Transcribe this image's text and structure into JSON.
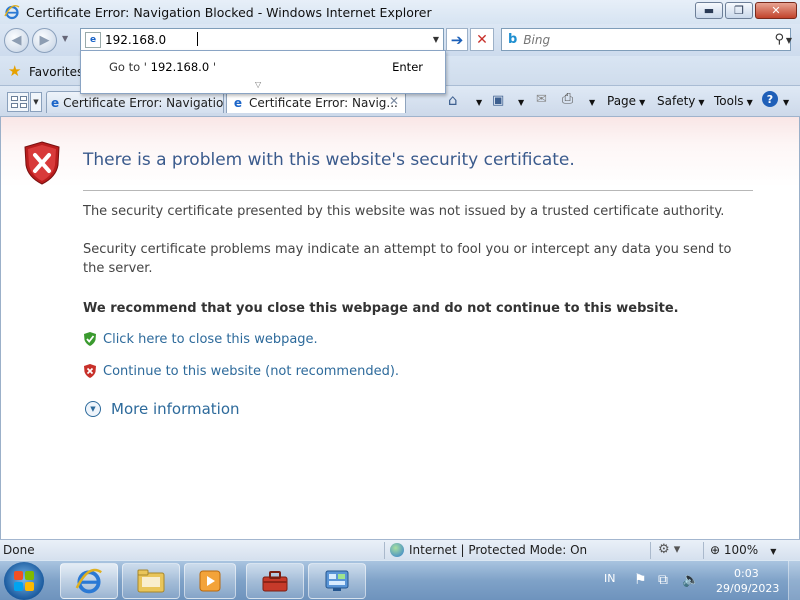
{
  "window": {
    "title": "Certificate Error: Navigation Blocked - Windows Internet Explorer",
    "minimize_glyph": "▬",
    "maximize_glyph": "❐",
    "close_glyph": "✕"
  },
  "address_bar": {
    "value": "192.168.0",
    "page_icon": "page-icon",
    "go_glyph": "➔",
    "stop_glyph": "✕"
  },
  "search": {
    "placeholder": "Bing",
    "provider_icon": "bing-icon",
    "provider_glyph": "b",
    "go_glyph": "⚲"
  },
  "autocomplete": {
    "goto_prefix": "Go to '",
    "goto_value": "192.168.0",
    "goto_suffix": "'",
    "enter_label": "Enter"
  },
  "favorites": {
    "label": "Favorites"
  },
  "tabs": [
    {
      "label": "Certificate Error: Navigatio...",
      "active": false
    },
    {
      "label": "Certificate Error: Navig...",
      "active": true
    }
  ],
  "command_bar": {
    "home_icon": "home-icon",
    "feeds_icon": "feeds-icon",
    "mail_icon": "mail-icon",
    "print_icon": "print-icon",
    "page_label": "Page",
    "safety_label": "Safety",
    "tools_label": "Tools",
    "help_icon": "help-icon"
  },
  "error_page": {
    "title": "There is a problem with this website's security certificate.",
    "p1": "The security certificate presented by this website was not issued by a trusted certificate authority.",
    "p2": "Security certificate problems may indicate an attempt to fool you or intercept any data you send to the server.",
    "recommend": "We recommend that you close this webpage and do not continue to this website.",
    "close_link": "Click here to close this webpage.",
    "continue_link": "Continue to this website (not recommended).",
    "more_info": "More information"
  },
  "status_bar": {
    "status": "Done",
    "zone": "Internet | Protected Mode: On",
    "zoom": "100%"
  },
  "taskbar": {
    "language": "IN",
    "time": "0:03",
    "date": "29/09/2023"
  },
  "colors": {
    "link": "#2d6a9b",
    "title": "#3a5a8c",
    "error_red": "#c8302a",
    "safe_green": "#3a9a2e"
  }
}
